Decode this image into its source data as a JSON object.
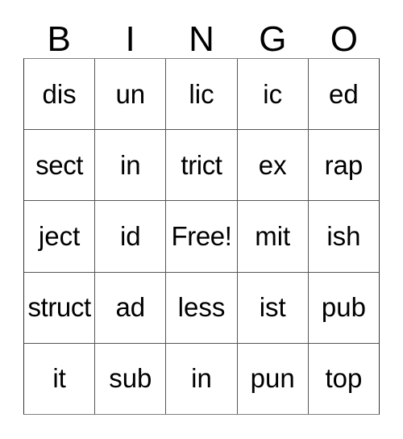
{
  "card": {
    "title": "BINGO",
    "header_letters": [
      "B",
      "I",
      "N",
      "G",
      "O"
    ],
    "free_space_label": "Free!",
    "colors": {
      "background": "#ffffff",
      "text": "#000000",
      "grid_line": "#555555",
      "outer_border": "#808080"
    },
    "grid": {
      "columns": 5,
      "rows": 5,
      "cells": [
        [
          {
            "text": "dis"
          },
          {
            "text": "un"
          },
          {
            "text": "lic"
          },
          {
            "text": "ic"
          },
          {
            "text": "ed"
          }
        ],
        [
          {
            "text": "sect"
          },
          {
            "text": "in"
          },
          {
            "text": "trict"
          },
          {
            "text": "ex"
          },
          {
            "text": "rap"
          }
        ],
        [
          {
            "text": "ject"
          },
          {
            "text": "id"
          },
          {
            "text": "Free!"
          },
          {
            "text": "mit"
          },
          {
            "text": "ish"
          }
        ],
        [
          {
            "text": "struct"
          },
          {
            "text": "ad"
          },
          {
            "text": "less"
          },
          {
            "text": "ist"
          },
          {
            "text": "pub"
          }
        ],
        [
          {
            "text": "it"
          },
          {
            "text": "sub"
          },
          {
            "text": "in"
          },
          {
            "text": "pun"
          },
          {
            "text": "top"
          }
        ]
      ]
    }
  }
}
